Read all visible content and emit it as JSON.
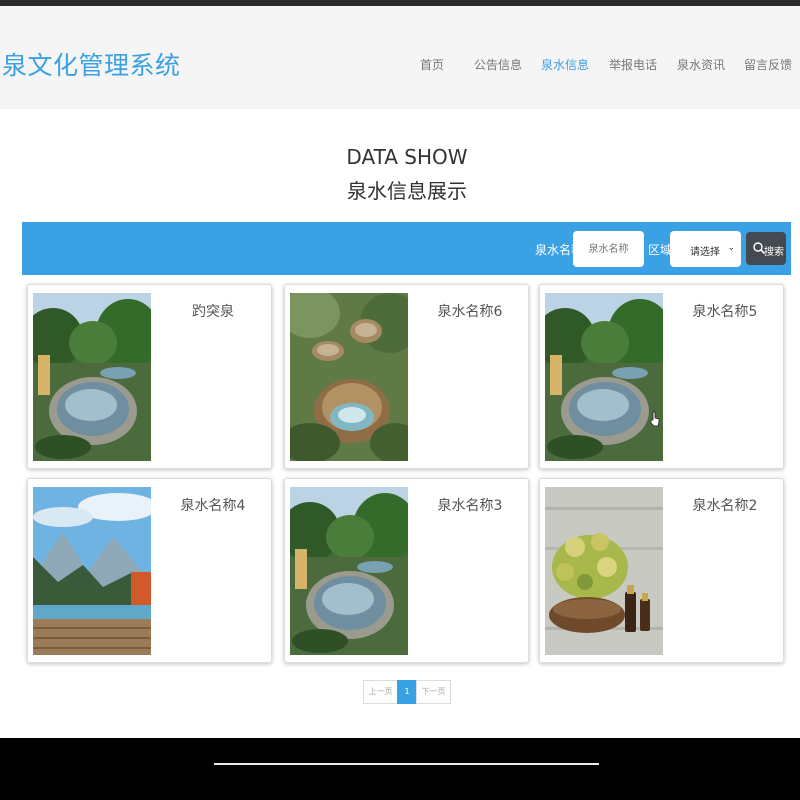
{
  "header": {
    "brand": "泉文化管理系统",
    "nav": [
      {
        "label": "首页",
        "active": false
      },
      {
        "label": "公告信息",
        "active": false
      },
      {
        "label": "泉水信息",
        "active": true
      },
      {
        "label": "举报电话",
        "active": false
      },
      {
        "label": "泉水资讯",
        "active": false
      },
      {
        "label": "留言反馈",
        "active": false
      }
    ]
  },
  "section": {
    "title_en": "DATA SHOW",
    "title_cn": "泉水信息展示"
  },
  "search": {
    "name_label": "泉水名称",
    "name_placeholder": "泉水名称",
    "area_label": "区域",
    "area_value": "请选择",
    "button_label": "搜索",
    "accent": "#3aa1e4"
  },
  "cards": [
    {
      "name": "趵突泉",
      "image": "round-pool-garden"
    },
    {
      "name": "泉水名称6",
      "image": "aerial-round-pools"
    },
    {
      "name": "泉水名称5",
      "image": "round-pool-garden"
    },
    {
      "name": "泉水名称4",
      "image": "mountain-infinity-pool"
    },
    {
      "name": "泉水名称3",
      "image": "round-pool-garden"
    },
    {
      "name": "泉水名称2",
      "image": "flowers-oil-bottles"
    }
  ],
  "pagination": {
    "prev": "上一页",
    "current": "1",
    "next": "下一页"
  }
}
